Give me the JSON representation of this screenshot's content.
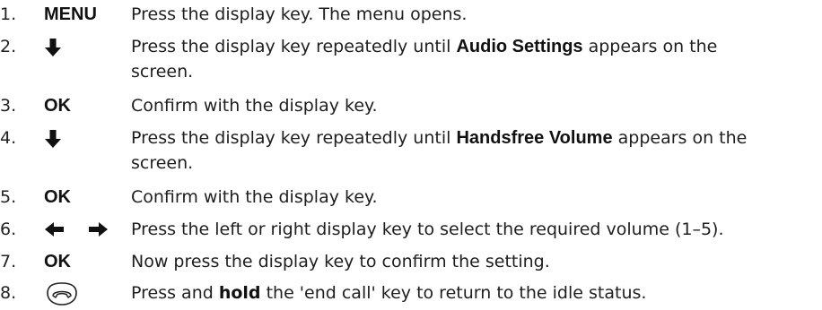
{
  "steps": [
    {
      "num": "1.",
      "key_label": "MENU",
      "desc": [
        {
          "text": "Press the display key. The menu opens.",
          "bold": false
        }
      ]
    },
    {
      "num": "2.",
      "key_icon": "down-arrow-icon",
      "desc": [
        {
          "text": "Press the display key repeatedly until ",
          "bold": false
        },
        {
          "text": "Audio Settings",
          "bold": true
        },
        {
          "text": " appears on the screen.",
          "bold": false
        }
      ]
    },
    {
      "num": "3.",
      "key_label": "OK",
      "desc": [
        {
          "text": "Confirm with the display key.",
          "bold": false
        }
      ]
    },
    {
      "num": "4.",
      "key_icon": "down-arrow-icon",
      "desc": [
        {
          "text": "Press the display key repeatedly until ",
          "bold": false
        },
        {
          "text": "Handsfree Volume",
          "bold": true
        },
        {
          "text": " appears on the screen.",
          "bold": false
        }
      ]
    },
    {
      "num": "5.",
      "key_label": "OK",
      "desc": [
        {
          "text": "Confirm with the display key.",
          "bold": false
        }
      ]
    },
    {
      "num": "6.",
      "key_icon": "left-right-arrows-icon",
      "desc": [
        {
          "text": "Press the left or right display key to select the required volume (1–5).",
          "bold": false
        }
      ]
    },
    {
      "num": "7.",
      "key_label": "OK",
      "desc": [
        {
          "text": "Now press the display key to confirm the setting.",
          "bold": false
        }
      ]
    },
    {
      "num": "8.",
      "key_icon": "end-call-key-icon",
      "desc": [
        {
          "text": "Press and ",
          "bold": false
        },
        {
          "text": "hold",
          "bold": true
        },
        {
          "text": " the 'end call' key to return to the idle status.",
          "bold": false
        }
      ]
    }
  ]
}
